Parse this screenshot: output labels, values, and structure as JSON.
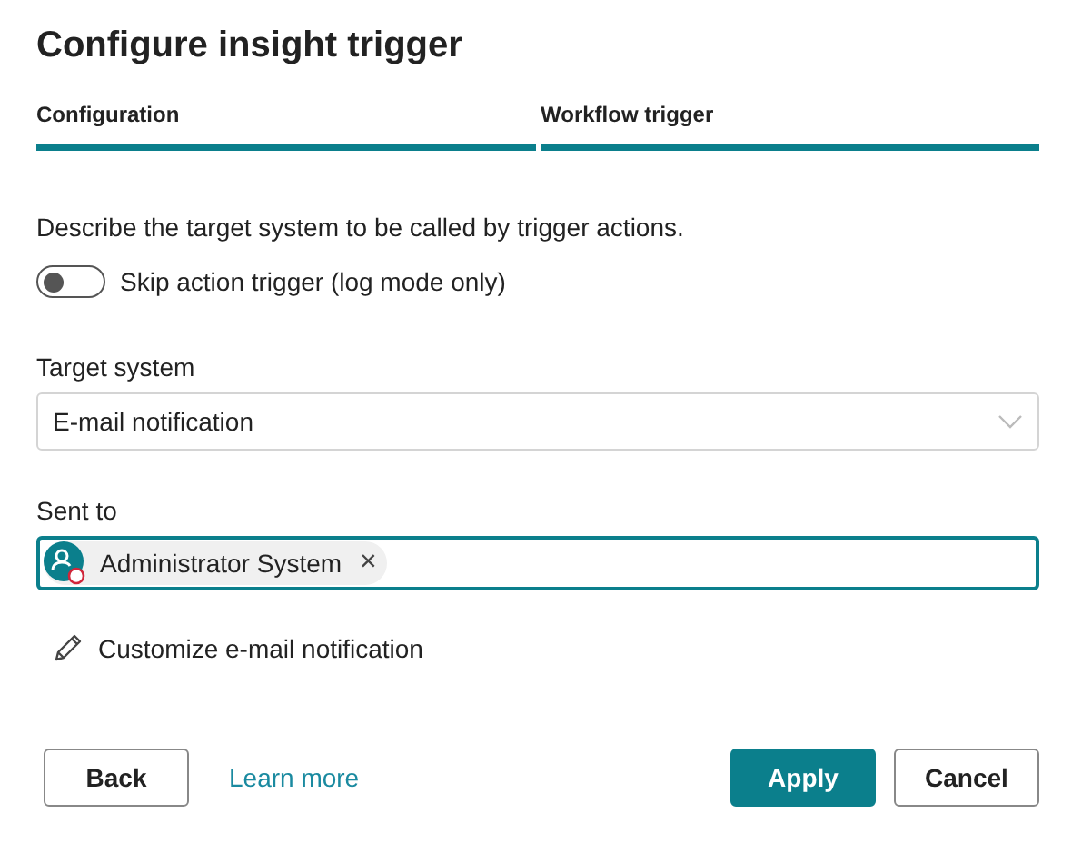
{
  "dialog": {
    "title": "Configure insight trigger"
  },
  "steps": [
    {
      "label": "Configuration",
      "done": true
    },
    {
      "label": "Workflow trigger",
      "done": true
    }
  ],
  "description": "Describe the target system to be called by trigger actions.",
  "toggle": {
    "label": "Skip action trigger (log mode only)",
    "on": false
  },
  "target_system": {
    "label": "Target system",
    "value": "E-mail notification"
  },
  "sent_to": {
    "label": "Sent to",
    "recipients": [
      {
        "name": "Administrator System",
        "remove": "×"
      }
    ]
  },
  "customize_link": "Customize e-mail notification",
  "buttons": {
    "back": "Back",
    "learn_more": "Learn more",
    "apply": "Apply",
    "cancel": "Cancel"
  }
}
